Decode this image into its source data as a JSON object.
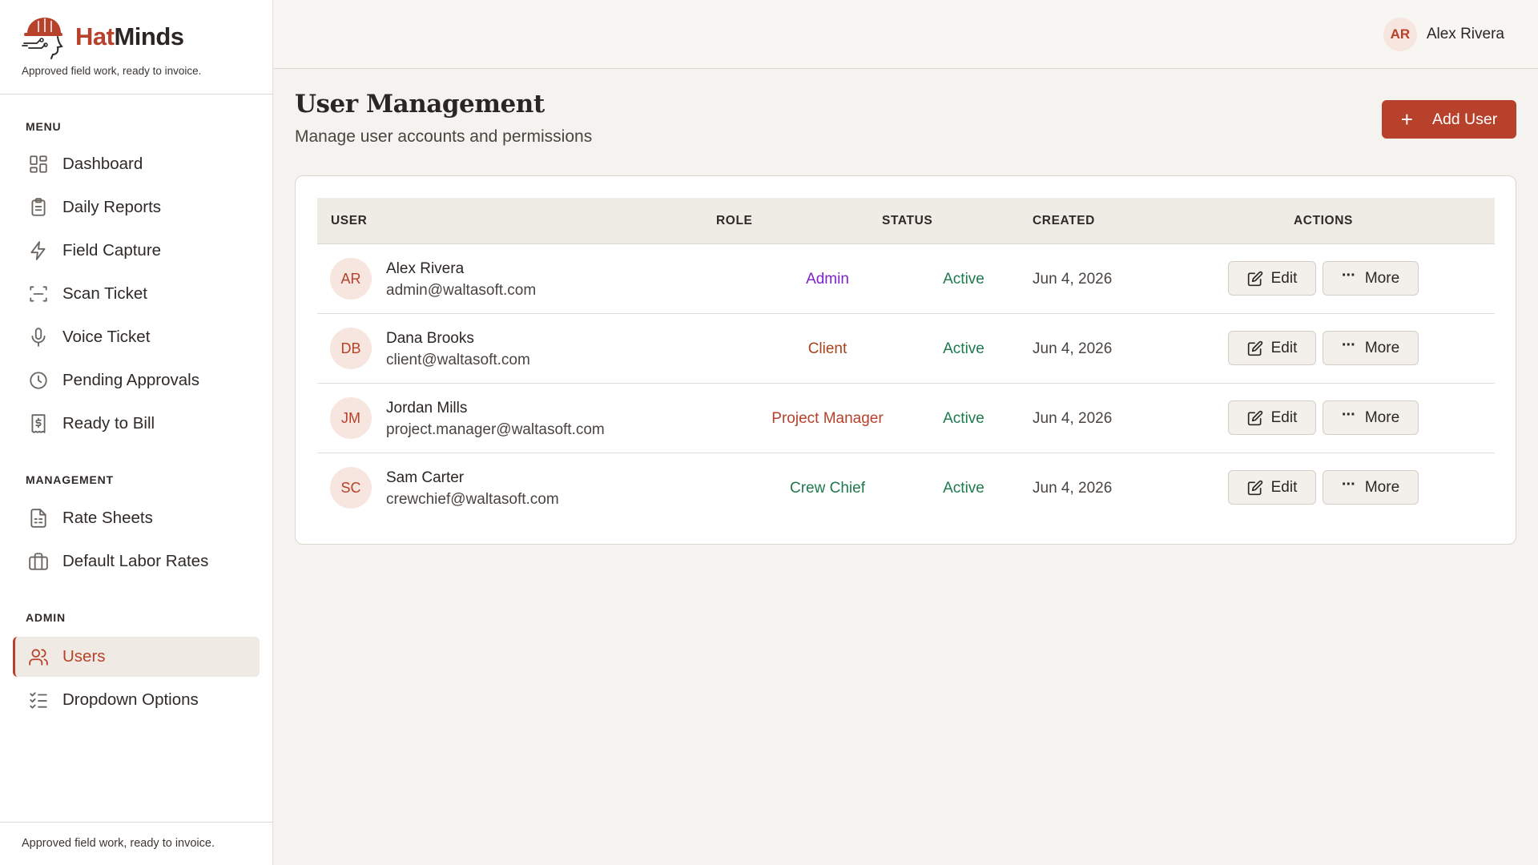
{
  "brand": {
    "name_part1": "Hat",
    "name_part2": "Minds",
    "tagline": "Approved field work, ready to invoice."
  },
  "sidebar": {
    "sections": {
      "menu": "MENU",
      "management": "MANAGEMENT",
      "admin": "ADMIN"
    },
    "items": [
      {
        "label": "Dashboard",
        "icon": "dashboard-icon"
      },
      {
        "label": "Daily Reports",
        "icon": "clipboard-icon"
      },
      {
        "label": "Field Capture",
        "icon": "lightning-icon"
      },
      {
        "label": "Scan Ticket",
        "icon": "scan-icon"
      },
      {
        "label": "Voice Ticket",
        "icon": "microphone-icon"
      },
      {
        "label": "Pending Approvals",
        "icon": "clock-icon"
      },
      {
        "label": "Ready to Bill",
        "icon": "invoice-dollar-icon"
      },
      {
        "label": "Rate Sheets",
        "icon": "document-icon"
      },
      {
        "label": "Default Labor Rates",
        "icon": "briefcase-icon"
      },
      {
        "label": "Users",
        "icon": "users-icon",
        "active": true
      },
      {
        "label": "Dropdown Options",
        "icon": "checklist-icon"
      }
    ],
    "footer": "Approved field work, ready to invoice."
  },
  "header": {
    "user_initials": "AR",
    "user_name": "Alex Rivera"
  },
  "page": {
    "title": "User Management",
    "subtitle": "Manage user accounts and permissions",
    "add_button": "Add User"
  },
  "table": {
    "columns": [
      "USER",
      "ROLE",
      "STATUS",
      "CREATED",
      "ACTIONS"
    ],
    "edit_label": "Edit",
    "more_label": "More",
    "rows": [
      {
        "initials": "AR",
        "name": "Alex Rivera",
        "email": "admin@waltasoft.com",
        "role": "Admin",
        "role_color": "#7e22ce",
        "status": "Active",
        "created": "Jun 4, 2026"
      },
      {
        "initials": "DB",
        "name": "Dana Brooks",
        "email": "client@waltasoft.com",
        "role": "Client",
        "role_color": "#a8431b",
        "status": "Active",
        "created": "Jun 4, 2026"
      },
      {
        "initials": "JM",
        "name": "Jordan Mills",
        "email": "project.manager@waltasoft.com",
        "role": "Project Manager",
        "role_color": "#b7412a",
        "status": "Active",
        "created": "Jun 4, 2026"
      },
      {
        "initials": "SC",
        "name": "Sam Carter",
        "email": "crewchief@waltasoft.com",
        "role": "Crew Chief",
        "role_color": "#1d7a4c",
        "status": "Active",
        "created": "Jun 4, 2026"
      }
    ]
  },
  "colors": {
    "accent": "#b7412a",
    "status_active": "#1d7a4c"
  }
}
